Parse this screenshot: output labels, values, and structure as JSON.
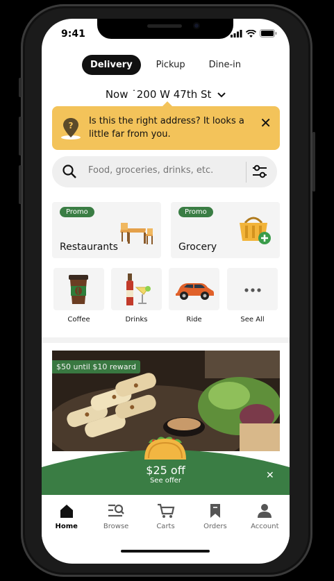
{
  "status": {
    "time": "9:41"
  },
  "modes": [
    {
      "label": "Delivery",
      "active": true
    },
    {
      "label": "Pickup"
    },
    {
      "label": "Dine-in"
    }
  ],
  "address": {
    "label": "Now ˙200 W 47th St"
  },
  "alert": {
    "text": "Is this the right address? It looks a little far from you.",
    "color": "#f3c35a"
  },
  "search": {
    "placeholder": "Food, groceries, drinks, etc."
  },
  "cards": [
    {
      "badge": "Promo",
      "title": "Restaurants"
    },
    {
      "badge": "Promo",
      "title": "Grocery"
    }
  ],
  "tiles": [
    {
      "label": "Coffee",
      "icon": "coffee-cup-icon"
    },
    {
      "label": "Drinks",
      "icon": "drinks-icon"
    },
    {
      "label": "Ride",
      "icon": "car-icon"
    },
    {
      "label": "See All",
      "icon": "more-dots-icon"
    }
  ],
  "promo": {
    "reward": "$50 until $10 reward"
  },
  "offer": {
    "title": "$25 off",
    "subtitle": "See offer",
    "icon": "taco-icon",
    "color": "#3a7d44"
  },
  "nav": [
    {
      "label": "Home",
      "icon": "home-icon",
      "active": true
    },
    {
      "label": "Browse",
      "icon": "browse-icon"
    },
    {
      "label": "Carts",
      "icon": "cart-icon"
    },
    {
      "label": "Orders",
      "icon": "bookmark-icon"
    },
    {
      "label": "Account",
      "icon": "account-icon"
    }
  ]
}
